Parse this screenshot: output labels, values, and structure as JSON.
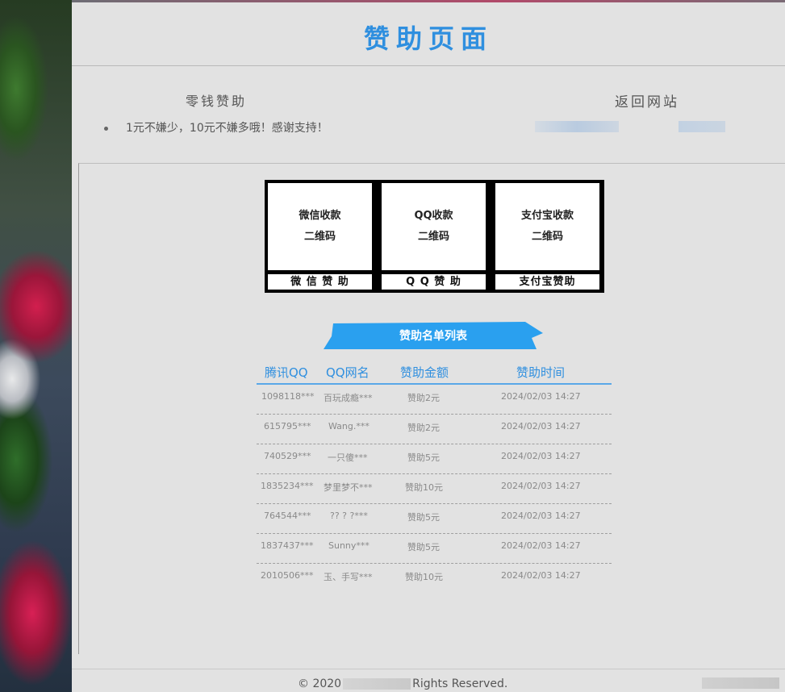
{
  "header": {
    "title": "赞助页面"
  },
  "info": {
    "left_title": "零钱赞助",
    "right_title": "返回网站",
    "bullet_text": "1元不嫌少，10元不嫌多哦！感谢支持！"
  },
  "qr": {
    "cards": [
      {
        "line1": "微信收款",
        "line2": "二维码",
        "label": "微 信 赞 助"
      },
      {
        "line1": "QQ收款",
        "line2": "二维码",
        "label": "Q Q 赞 助"
      },
      {
        "line1": "支付宝收款",
        "line2": "二维码",
        "label": "支付宝赞助"
      }
    ]
  },
  "list": {
    "ribbon_title": "赞助名单列表",
    "columns": [
      "腾讯QQ",
      "QQ网名",
      "赞助金额",
      "赞助时间"
    ],
    "rows": [
      {
        "qq": "1098118***",
        "name": "百玩成瘾***",
        "amount": "赞助2元",
        "time": "2024/02/03 14:27"
      },
      {
        "qq": "615795***",
        "name": "Wang.***",
        "amount": "赞助2元",
        "time": "2024/02/03 14:27"
      },
      {
        "qq": "740529***",
        "name": "一只傻***",
        "amount": "赞助5元",
        "time": "2024/02/03 14:27"
      },
      {
        "qq": "1835234***",
        "name": "梦里梦不***",
        "amount": "赞助10元",
        "time": "2024/02/03 14:27"
      },
      {
        "qq": "764544***",
        "name": "?? ? ?***",
        "amount": "赞助5元",
        "time": "2024/02/03 14:27"
      },
      {
        "qq": "1837437***",
        "name": "Sunny***",
        "amount": "赞助5元",
        "time": "2024/02/03 14:27"
      },
      {
        "qq": "2010506***",
        "name": "玉、手写***",
        "amount": "赞助10元",
        "time": "2024/02/03 14:27"
      }
    ]
  },
  "footer": {
    "prefix": "© 2020",
    "suffix": "Rights Reserved."
  },
  "colors": {
    "accent": "#2f8fdf",
    "ribbon": "#2aa0ef",
    "panel": "#e2e2e2"
  }
}
